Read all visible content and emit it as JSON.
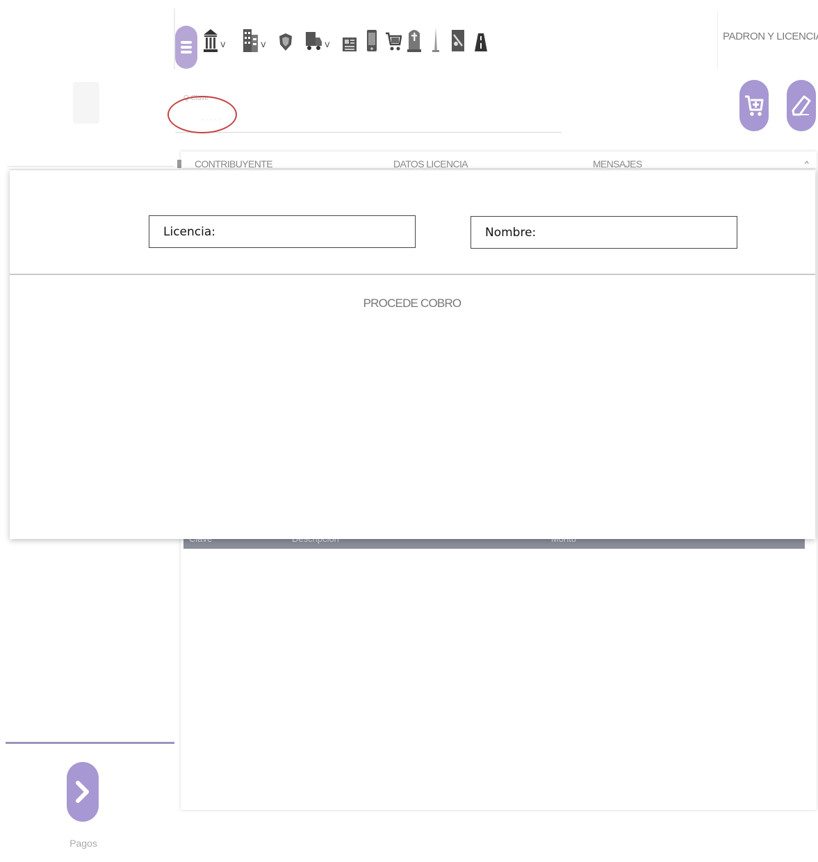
{
  "header": {
    "module_title": "PADRON Y LICENCIAS",
    "toolbar_icons": [
      "museum-icon",
      "building-icon",
      "shield-icon",
      "truck-icon",
      "newspaper-icon",
      "phone-icon",
      "cart-icon",
      "tombstone-icon",
      "tower-icon",
      "document-icon",
      "road-icon"
    ],
    "chevron": "v"
  },
  "search": {
    "hint": "Q Clave",
    "dots": "· · · · ·"
  },
  "tabs": {
    "contribuyente": "CONTRIBUYENTE",
    "datos_licencia": "DATOS LICENCIA",
    "mensajes": "MENSAJES",
    "scroll": "^"
  },
  "table": {
    "columns": [
      "Clave",
      "Descripcion",
      "Monto"
    ]
  },
  "modal": {
    "licencia_label": "Licencia:",
    "nombre_label": "Nombre:",
    "procede_cobro": "PROCEDE COBRO"
  },
  "sidebar": {
    "pagos_label": "Pagos"
  },
  "colors": {
    "accent": "#a797d2",
    "highlight_ellipse": "#c44343",
    "table_header": "#8a8e9a"
  }
}
